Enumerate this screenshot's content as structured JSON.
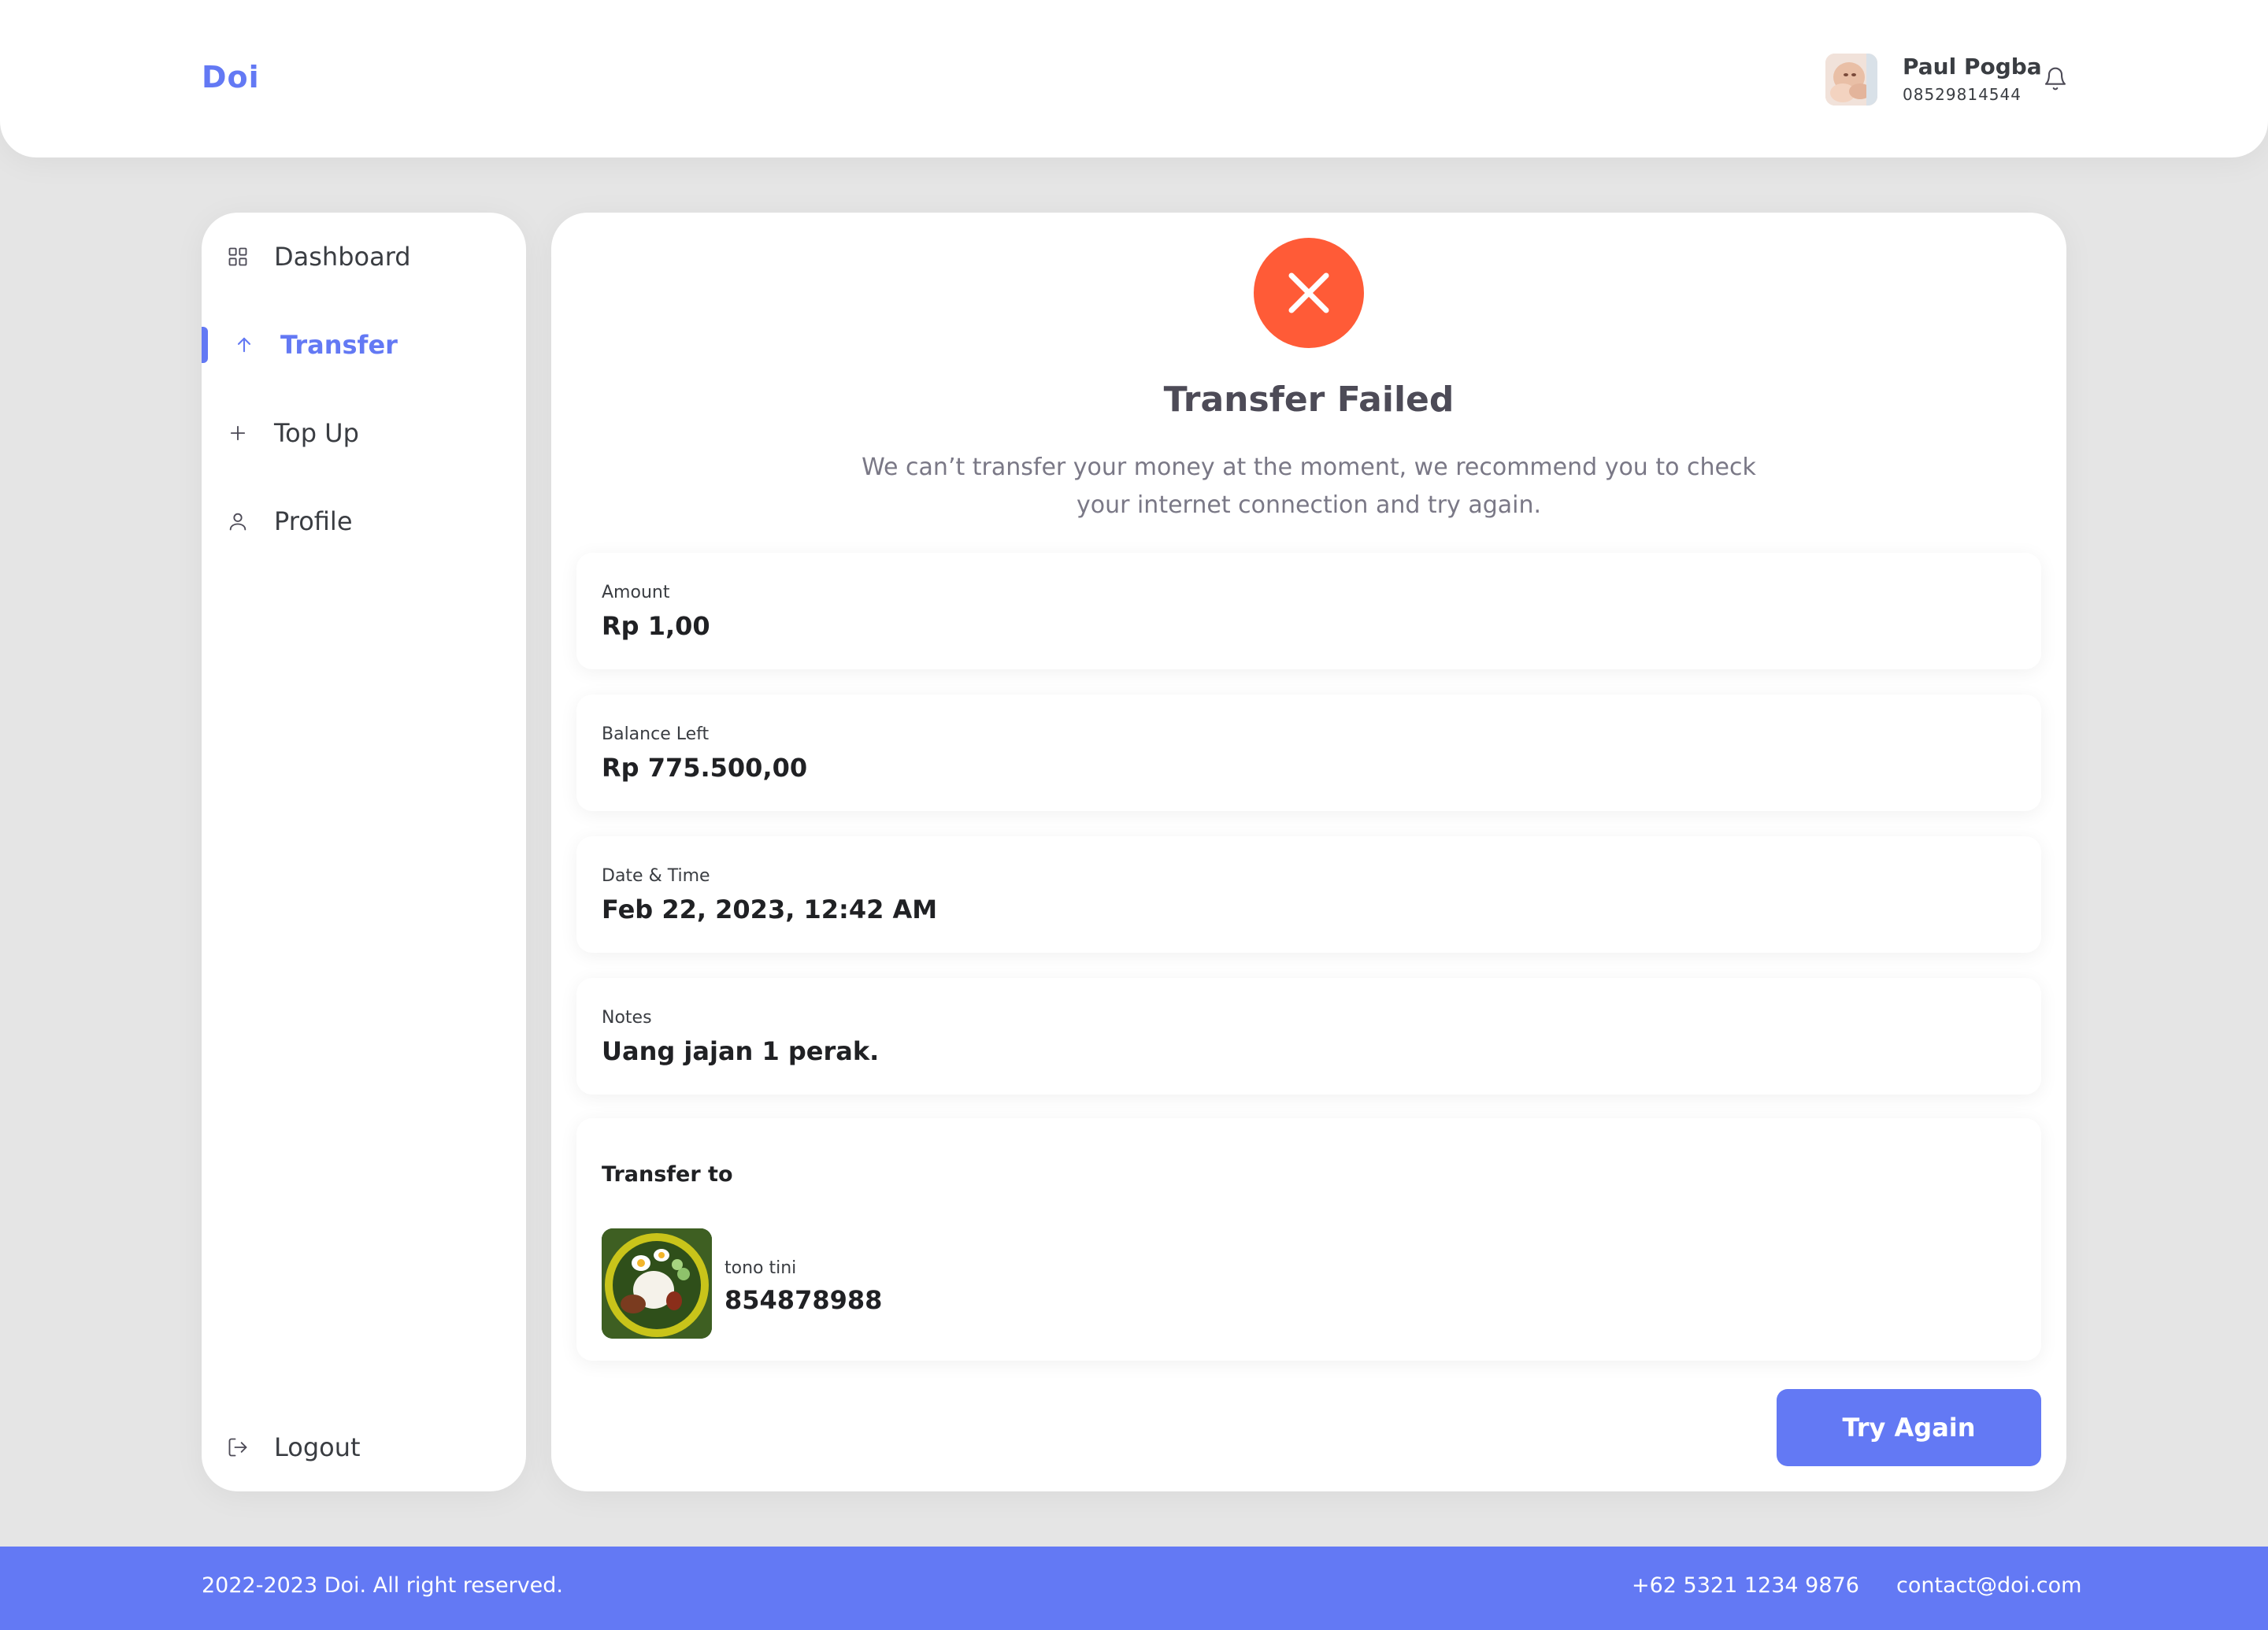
{
  "brand": "Doi",
  "user": {
    "name": "Paul Pogba",
    "phone": "08529814544"
  },
  "sidebar": {
    "items": [
      {
        "label": "Dashboard",
        "icon": "grid-icon"
      },
      {
        "label": "Transfer",
        "icon": "arrow-up-icon",
        "active": true
      },
      {
        "label": "Top Up",
        "icon": "plus-icon"
      },
      {
        "label": "Profile",
        "icon": "user-icon"
      }
    ],
    "logout": {
      "label": "Logout",
      "icon": "logout-icon"
    }
  },
  "result": {
    "status_icon": "close-icon",
    "title": "Transfer Failed",
    "description": "We can’t transfer your money at the moment, we recommend you to check your internet connection and try again."
  },
  "details": [
    {
      "label": "Amount",
      "value": "Rp 1,00"
    },
    {
      "label": "Balance Left",
      "value": "Rp 775.500,00"
    },
    {
      "label": "Date & Time",
      "value": "Feb 22, 2023, 12:42 AM"
    },
    {
      "label": "Notes",
      "value": "Uang jajan 1 perak."
    }
  ],
  "recipient": {
    "title": "Transfer to",
    "name": "tono tini",
    "number": "854878988"
  },
  "actions": {
    "try_again": "Try Again"
  },
  "footer": {
    "copyright": "2022-2023 Doi. All right reserved.",
    "phone": "+62 5321 1234 9876",
    "email": "contact@doi.com"
  },
  "colors": {
    "primary": "#6379f4",
    "error": "#ff5b37",
    "background": "#e5e5e5"
  }
}
